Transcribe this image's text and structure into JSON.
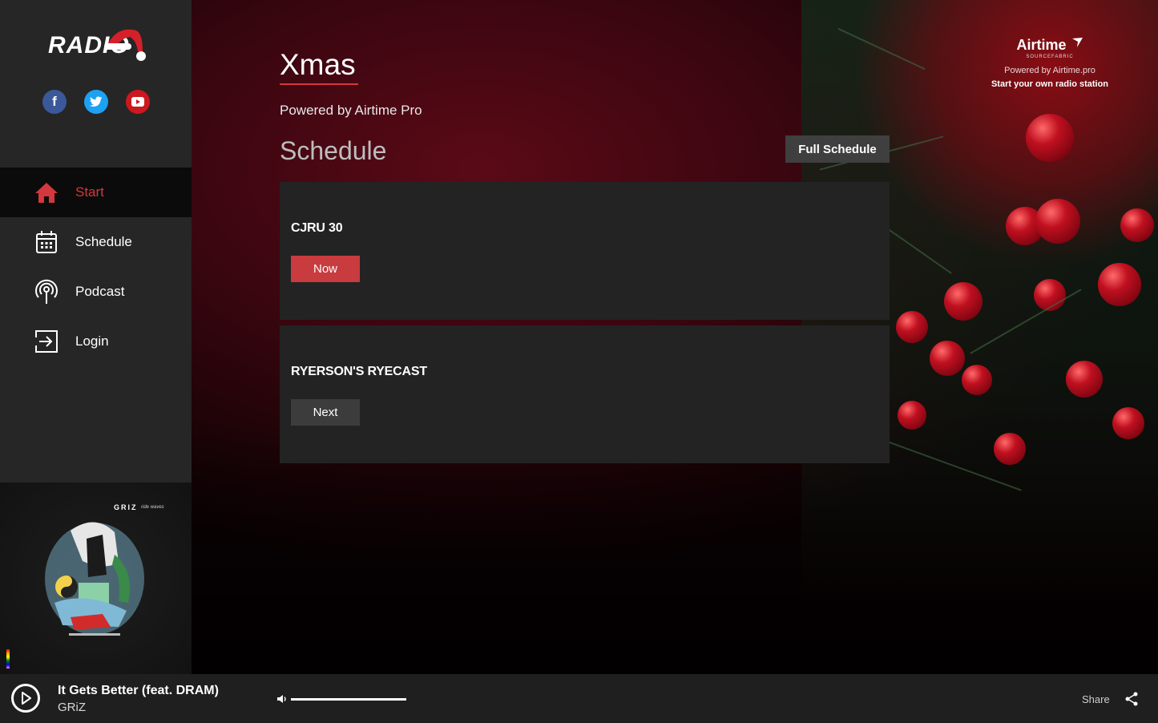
{
  "brand": {
    "logo_text": "RADIO"
  },
  "socials": [
    {
      "label": "f",
      "icon": "facebook-icon"
    },
    {
      "label": "t",
      "icon": "twitter-icon"
    },
    {
      "label": "▶",
      "icon": "youtube-icon"
    }
  ],
  "nav": {
    "items": [
      {
        "label": "Start",
        "icon": "home-icon",
        "active": true
      },
      {
        "label": "Schedule",
        "icon": "calendar-icon",
        "active": false
      },
      {
        "label": "Podcast",
        "icon": "podcast-icon",
        "active": false
      },
      {
        "label": "Login",
        "icon": "login-icon",
        "active": false
      }
    ]
  },
  "album": {
    "artist_text": "GRIZ",
    "album_text": "ride waves"
  },
  "main": {
    "title": "Xmas",
    "tagline": "Powered by Airtime Pro",
    "section_title": "Schedule",
    "full_schedule_label": "Full Schedule",
    "shows": [
      {
        "name": "CJRU 30",
        "status": "Now"
      },
      {
        "name": "RYERSON'S RYECAST",
        "status": "Next"
      }
    ]
  },
  "airtime": {
    "logo": "Airtime",
    "sub": "SOURCEFABRIC",
    "line1": "Powered by Airtime.pro",
    "line2": "Start your own radio station"
  },
  "player": {
    "track_title": "It Gets Better (feat. DRAM)",
    "track_artist": "GRiZ",
    "volume_fraction": 1.0,
    "share_label": "Share"
  },
  "colors": {
    "accent": "#c83b3e",
    "sidebar": "#262626",
    "card": "#232323"
  }
}
